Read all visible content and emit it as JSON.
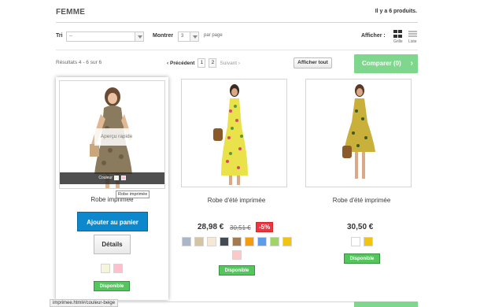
{
  "header": {
    "title": "FEMME",
    "count": "Il y a 6 produits."
  },
  "sort": {
    "label": "Tri",
    "value": "--"
  },
  "show": {
    "label": "Montrer",
    "value": "3",
    "suffix": "par page"
  },
  "view": {
    "label": "Afficher :",
    "grid": "Grille",
    "list": "Liste"
  },
  "pagination": {
    "results": "Résultats 4 - 6 sur 6",
    "prev": "Précédent",
    "pages": [
      "1",
      "2"
    ],
    "next": "Suivant",
    "show_all": "Afficher tout"
  },
  "compare": {
    "label": "Comparer (0)",
    "chevron": "›"
  },
  "products": [
    {
      "name": "Robe imprimée",
      "quick_view": "Aperçu rapide",
      "color_label": "Couleur",
      "tooltip": "Robe imprimée",
      "add_to_cart": "Ajouter au panier",
      "details": "Détails",
      "availability": "Disponible",
      "swatches": [
        "#f5f5dc",
        "#ffc0cb"
      ]
    },
    {
      "name": "Robe d'été imprimée",
      "price": "28,98 €",
      "old_price": "30,51 €",
      "reduction": "-5%",
      "availability": "Disponible",
      "swatches": [
        "#a9b7c9",
        "#d5c4a1",
        "#f5e9d5",
        "#434a54",
        "#a37b50",
        "#f39c11",
        "#5d9cec",
        "#a0d468",
        "#f1c40f",
        "#fcc8c8"
      ]
    },
    {
      "name": "Robe d'été imprimée",
      "price": "30,50 €",
      "availability": "Disponible",
      "swatches": [
        "#ffffff",
        "#f1c40f"
      ]
    }
  ],
  "status_url": "imprimee.html#/couleur-beige",
  "colors": {
    "compare_bg": "#7fd78d",
    "cart_bg": "#0e88cc",
    "available": "#55c65e",
    "discount": "#f13340"
  }
}
